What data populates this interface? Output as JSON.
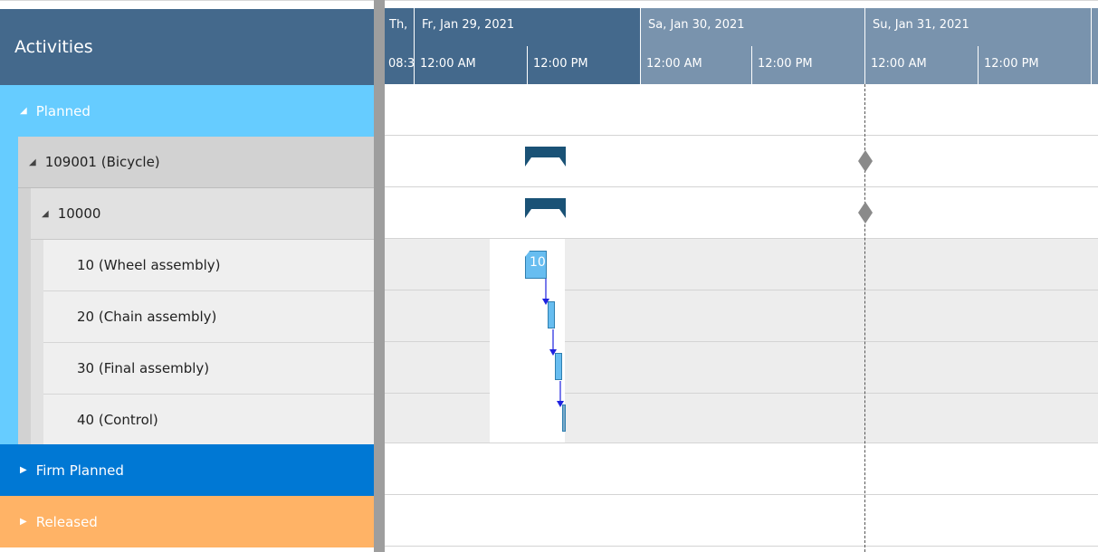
{
  "activities": {
    "header": "Activities",
    "planned": "Planned",
    "order": "109001 (Bicycle)",
    "sub_order": "10000",
    "operations": [
      "10 (Wheel assembly)",
      "20 (Chain assembly)",
      "30 (Final assembly)",
      "40 (Control)"
    ],
    "firm_planned": "Firm Planned",
    "released": "Released"
  },
  "timeline": {
    "days": [
      "Th,",
      "Fr, Jan 29, 2021",
      "Sa, Jan 30, 2021",
      "Su, Jan 31, 2021"
    ],
    "hours": [
      "08:3",
      "12:00 AM",
      "12:00 PM",
      "12:00 AM",
      "12:00 PM",
      "12:00 AM",
      "12:00 PM"
    ]
  },
  "tasks": {
    "t1_label": "10"
  },
  "colors": {
    "header_bg": "#44698c",
    "header_bg_light": "#7993ad",
    "planned": "#66ccff",
    "firm_planned": "#0078d4",
    "released": "#ffb366",
    "summary_bar": "#1a5276",
    "milestone": "#8a8a8a",
    "link": "#1e22e0"
  }
}
